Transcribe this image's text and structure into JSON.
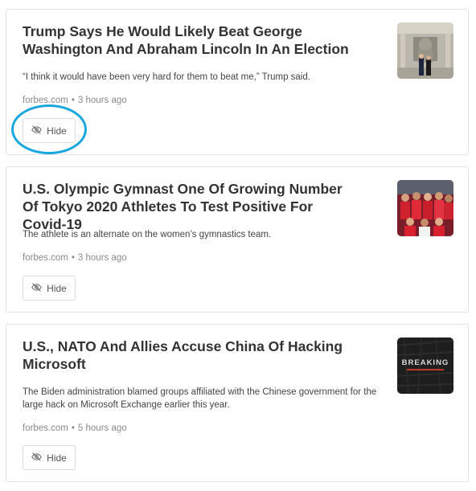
{
  "articles": [
    {
      "title": "Trump Says He Would Likely Beat George Washington And Abraham Lincoln In An Election",
      "description": "“I think it would have been very hard for them to beat me,” Trump said.",
      "source": "forbes.com",
      "separator": "•",
      "time": "3 hours ago",
      "hide_label": "Hide",
      "thumbnail_icon": "photo-trump-memorial"
    },
    {
      "title": "U.S. Olympic Gymnast One Of Growing Number Of Tokyo 2020 Athletes To Test Positive For Covid-19",
      "description": "The athlete is an alternate on the women’s gymnastics team.",
      "source": "forbes.com",
      "separator": "•",
      "time": "3 hours ago",
      "hide_label": "Hide",
      "thumbnail_icon": "photo-gymnastics-team"
    },
    {
      "title": "U.S., NATO And Allies Accuse China Of Hacking Microsoft",
      "description": "The Biden administration blamed groups affiliated with the Chinese government for the large hack on Microsoft Exchange earlier this year.",
      "source": "forbes.com",
      "separator": "•",
      "time": "5 hours ago",
      "hide_label": "Hide",
      "thumbnail_icon": "breaking-news-graphic",
      "thumbnail_text": "BREAKING"
    }
  ],
  "colors": {
    "highlight": "#1aa7e0",
    "title": "#333333",
    "meta": "#8a8a8a",
    "breaking_red": "#c0392b"
  },
  "annotation": "highlight-circle-around-first-hide-button"
}
